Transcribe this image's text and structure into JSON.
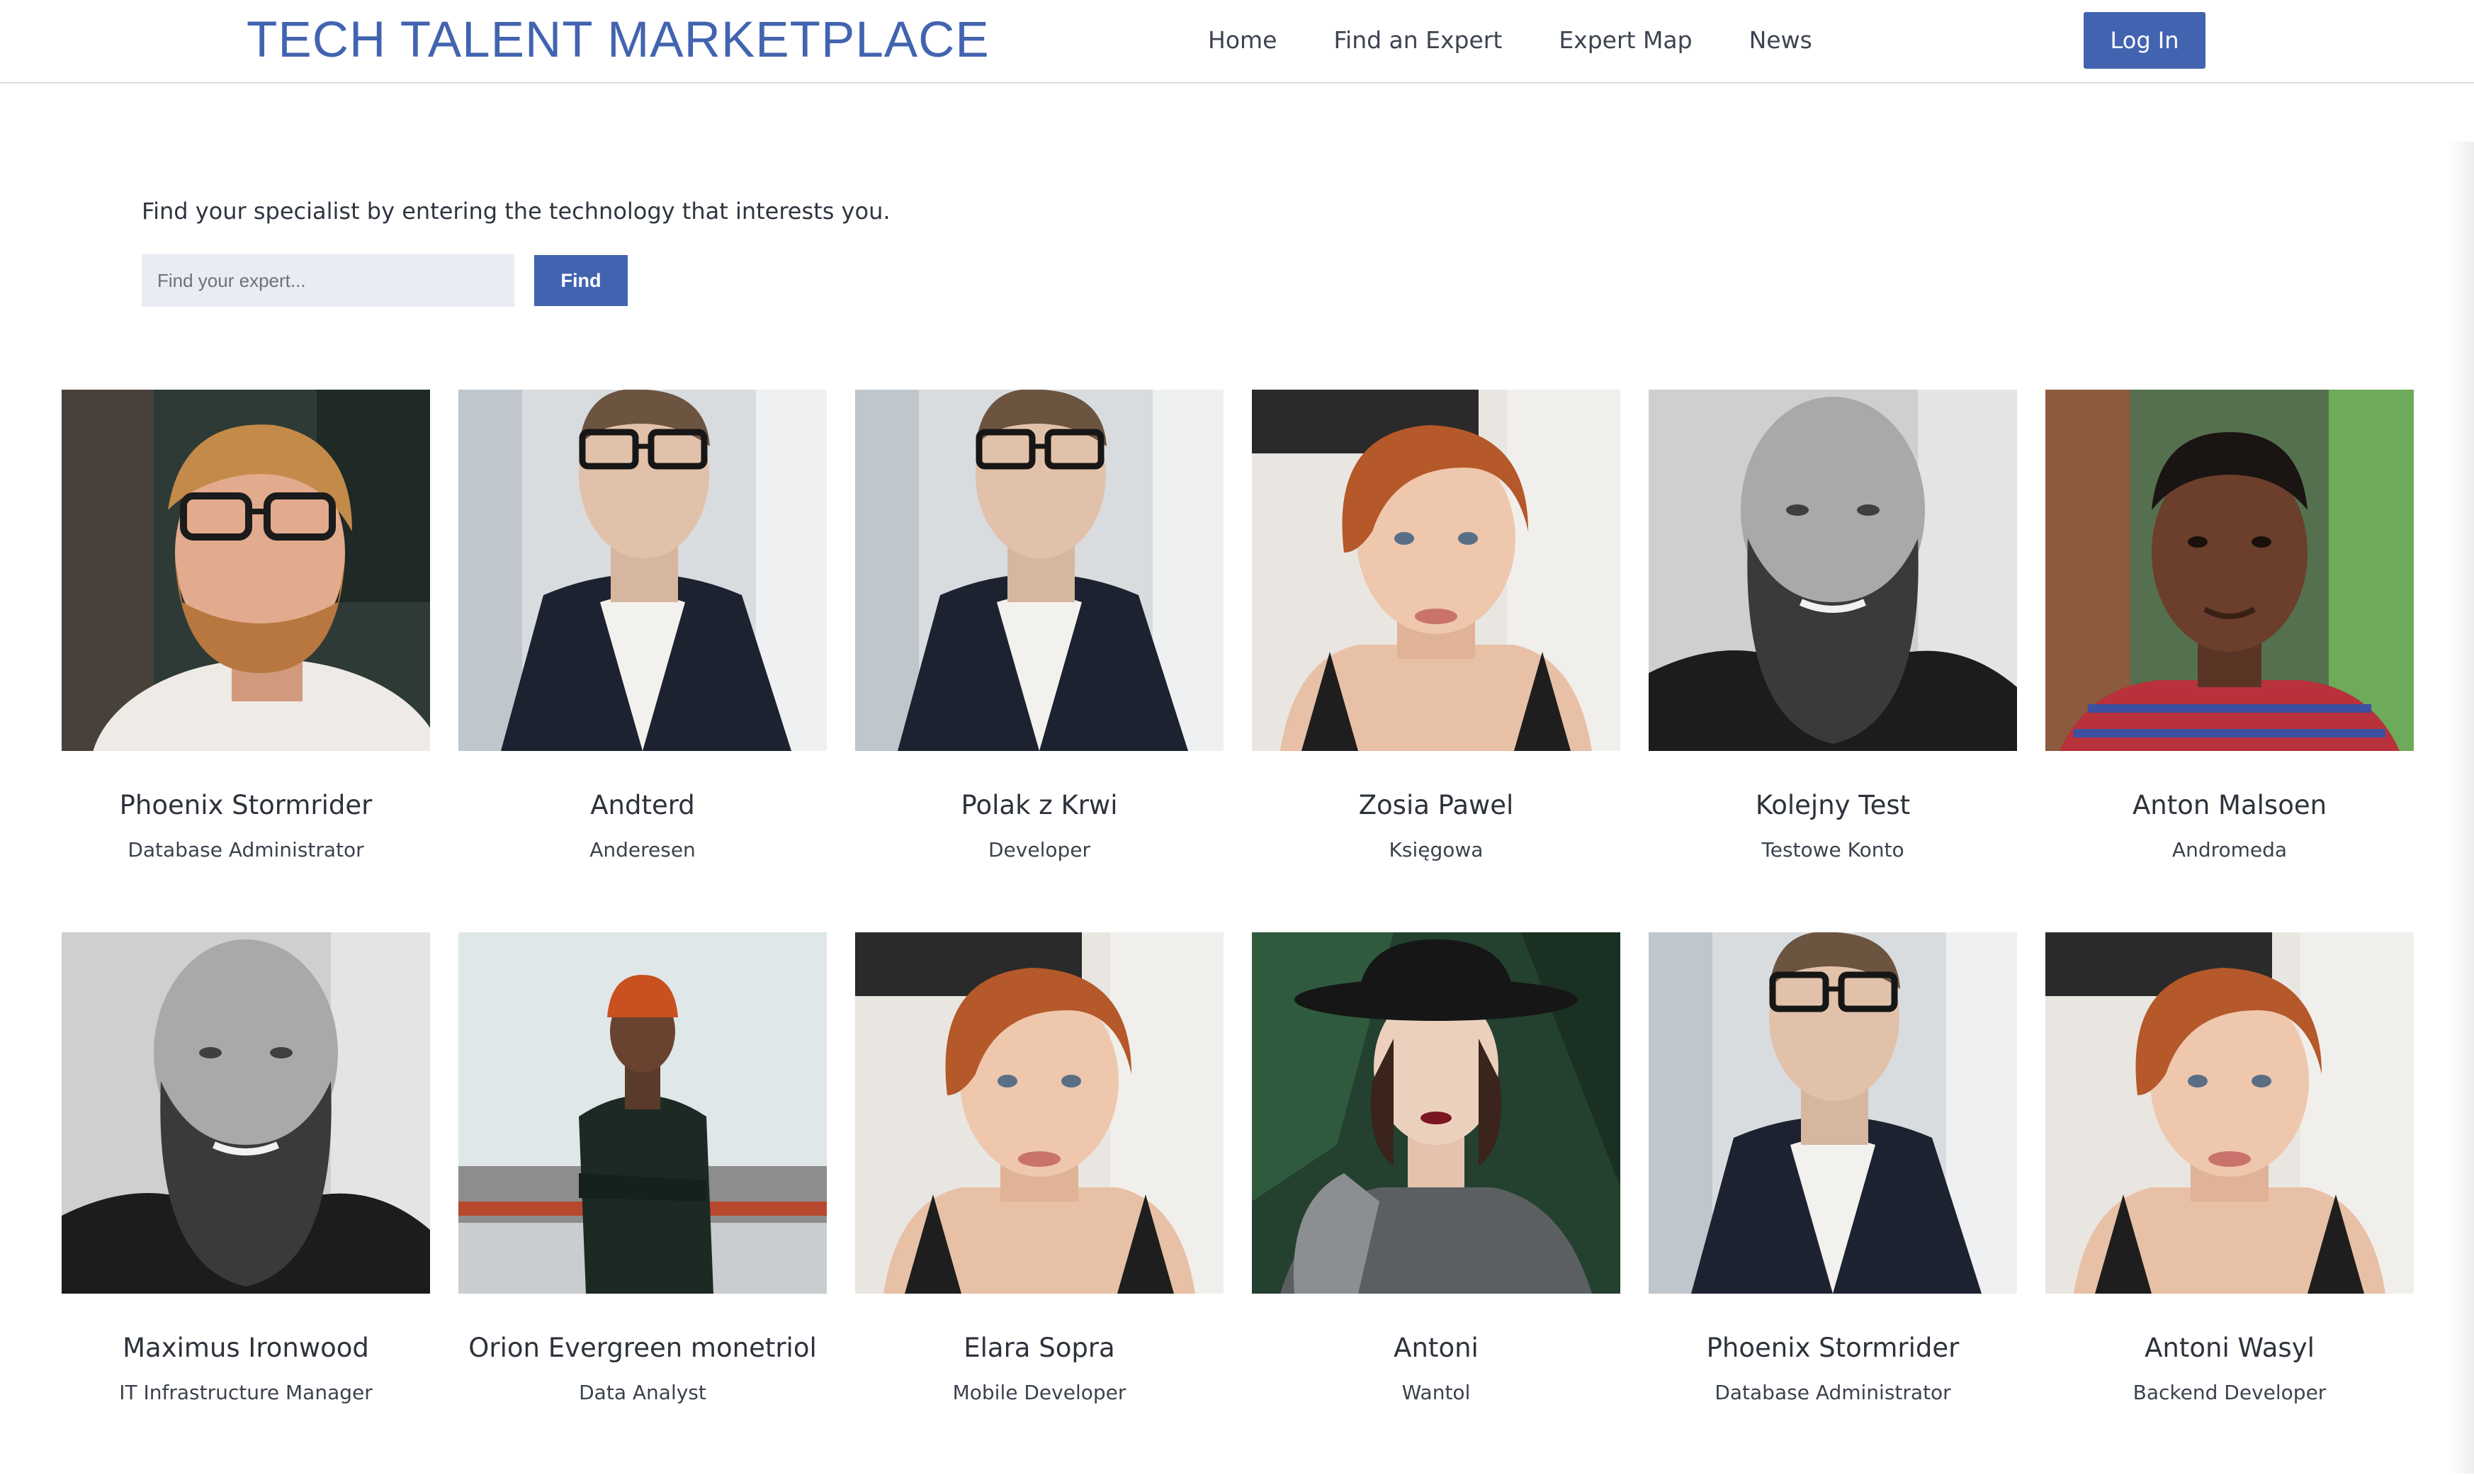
{
  "header": {
    "brand": "TECH TALENT MARKETPLACE",
    "nav": [
      "Home",
      "Find an Expert",
      "Expert Map",
      "News"
    ],
    "login_label": "Log In"
  },
  "search": {
    "prompt": "Find your specialist by entering the technology that interests you.",
    "placeholder": "Find your expert...",
    "button_label": "Find"
  },
  "colors": {
    "accent": "#4264b0",
    "input_bg": "#e9ecf3"
  },
  "experts": [
    {
      "name": "Phoenix Stormrider",
      "role": "Database Administrator",
      "photo": "bearded-glasses-man-portrait"
    },
    {
      "name": "Andterd",
      "role": "Anderesen",
      "photo": "man-glasses-suit-portrait"
    },
    {
      "name": "Polak z Krwi",
      "role": "Developer",
      "photo": "man-glasses-suit-portrait"
    },
    {
      "name": "Zosia Pawel",
      "role": "Księgowa",
      "photo": "redhead-woman-portrait"
    },
    {
      "name": "Kolejny Test",
      "role": "Testowe Konto",
      "photo": "bald-bearded-man-bw-portrait"
    },
    {
      "name": "Anton Malsoen",
      "role": "Andromeda",
      "photo": "man-plaid-shirt-portrait"
    },
    {
      "name": "Maximus Ironwood",
      "role": "IT Infrastructure Manager",
      "photo": "bald-bearded-man-bw-portrait"
    },
    {
      "name": "Orion Evergreen monetriol",
      "role": "Data Analyst",
      "photo": "man-beanie-turtleneck-portrait"
    },
    {
      "name": "Elara Sopra",
      "role": "Mobile Developer",
      "photo": "redhead-woman-portrait"
    },
    {
      "name": "Antoni",
      "role": "Wantol",
      "photo": "woman-black-hat-portrait"
    },
    {
      "name": "Phoenix Stormrider",
      "role": "Database Administrator",
      "photo": "man-glasses-suit-portrait"
    },
    {
      "name": "Antoni Wasyl",
      "role": "Backend Developer",
      "photo": "redhead-woman-portrait"
    }
  ]
}
